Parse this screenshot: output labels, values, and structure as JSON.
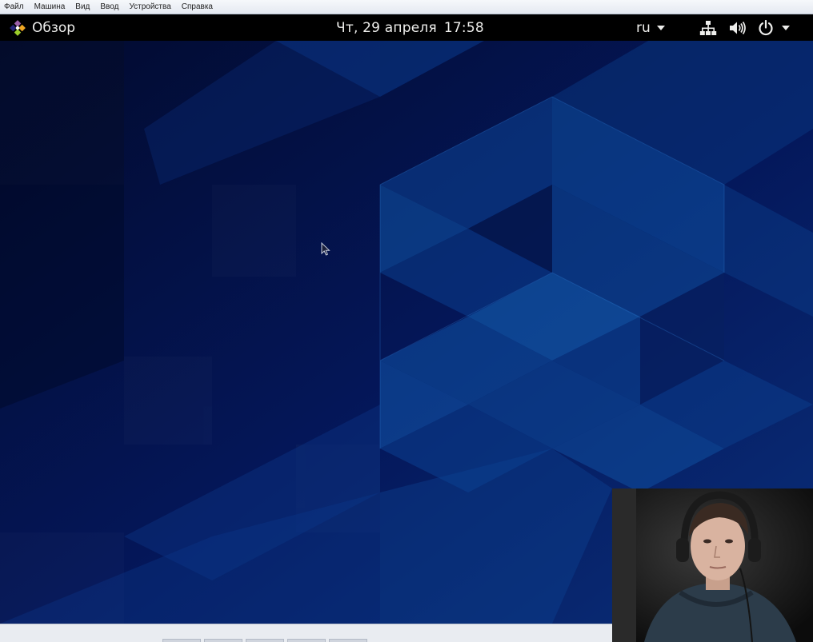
{
  "vm_menu": {
    "items": [
      "Файл",
      "Машина",
      "Вид",
      "Ввод",
      "Устройства",
      "Справка"
    ]
  },
  "topbar": {
    "activities_label": "Обзор",
    "date": "Чт, 29 апреля",
    "time": "17:58",
    "keyboard_layout": "ru"
  },
  "icons": {
    "activities": "distro-logo-icon",
    "layout_menu": "chevron-down-icon",
    "network": "network-wired-icon",
    "volume": "speaker-volume-icon",
    "power": "power-icon",
    "system_menu": "chevron-down-icon",
    "pointer": "mouse-pointer-icon"
  },
  "colors": {
    "topbar_bg": "#000000",
    "topbar_text": "#eeeeec",
    "wallpaper_base": "#041449",
    "wallpaper_accent": "#0d4f9c"
  }
}
